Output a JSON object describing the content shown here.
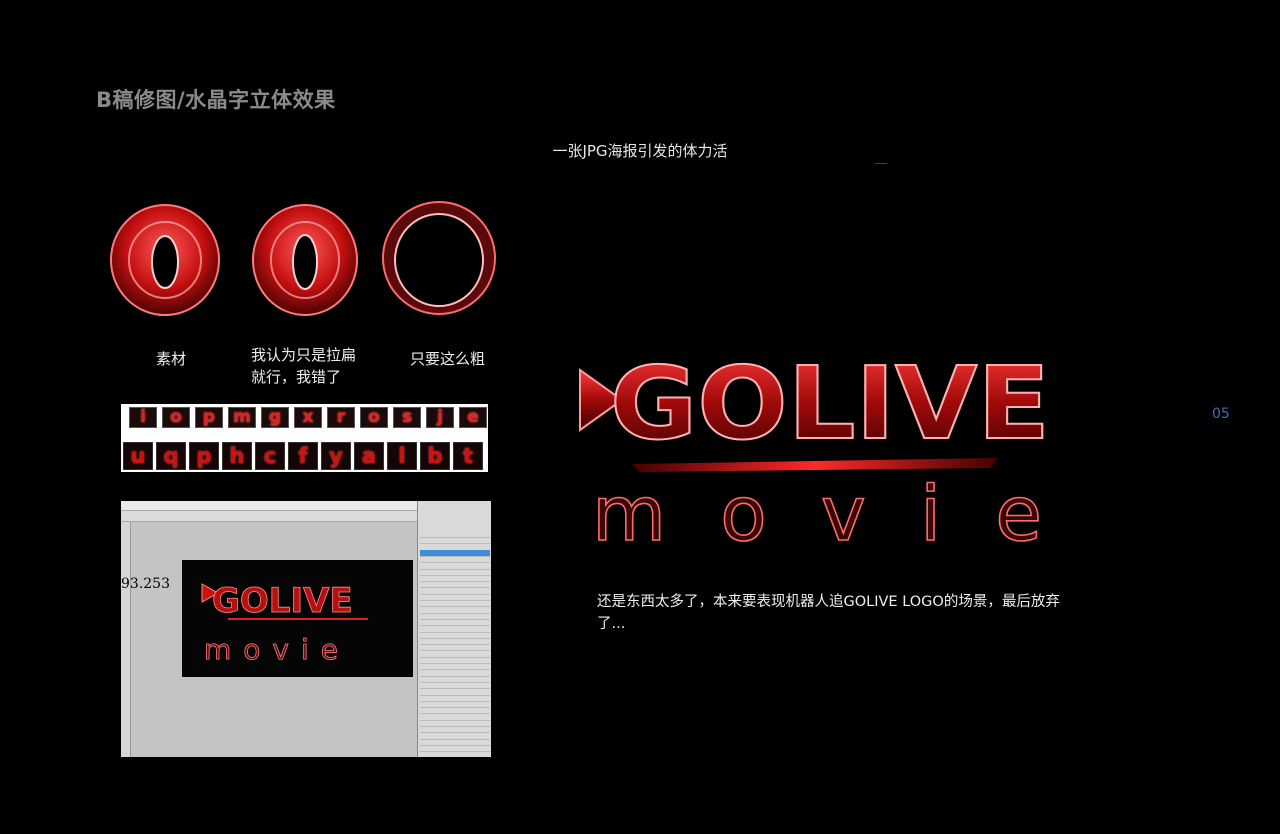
{
  "page": {
    "title": "B稿修图/水晶字立体效果",
    "subtitle": "一张JPG海报引发的体力活",
    "page_number": "05"
  },
  "samples": [
    {
      "caption": "素材"
    },
    {
      "caption": "我认为只是拉扁\n就行，我错了"
    },
    {
      "caption": "只要这么粗"
    }
  ],
  "glyph_strip": {
    "row1": [
      "i",
      "o",
      "p",
      "m",
      "g",
      "x",
      "r",
      "o",
      "s",
      "j",
      "e"
    ],
    "row2": [
      "u",
      "q",
      "p",
      "h",
      "c",
      "f",
      "y",
      "a",
      "l",
      "b",
      "t"
    ]
  },
  "photoshop": {
    "coordinate_readout": "93.253",
    "logo_top": "GOLIVE",
    "logo_bottom": "movie"
  },
  "main_logo": {
    "top": "GOLIVE",
    "bottom": "movie"
  },
  "note": "还是东西太多了，本来要表现机器人追GOLIVE LOGO的场景，最后放弃了...",
  "colors": {
    "accent_red": "#e01a1a",
    "page_number": "#3a6fb5"
  }
}
